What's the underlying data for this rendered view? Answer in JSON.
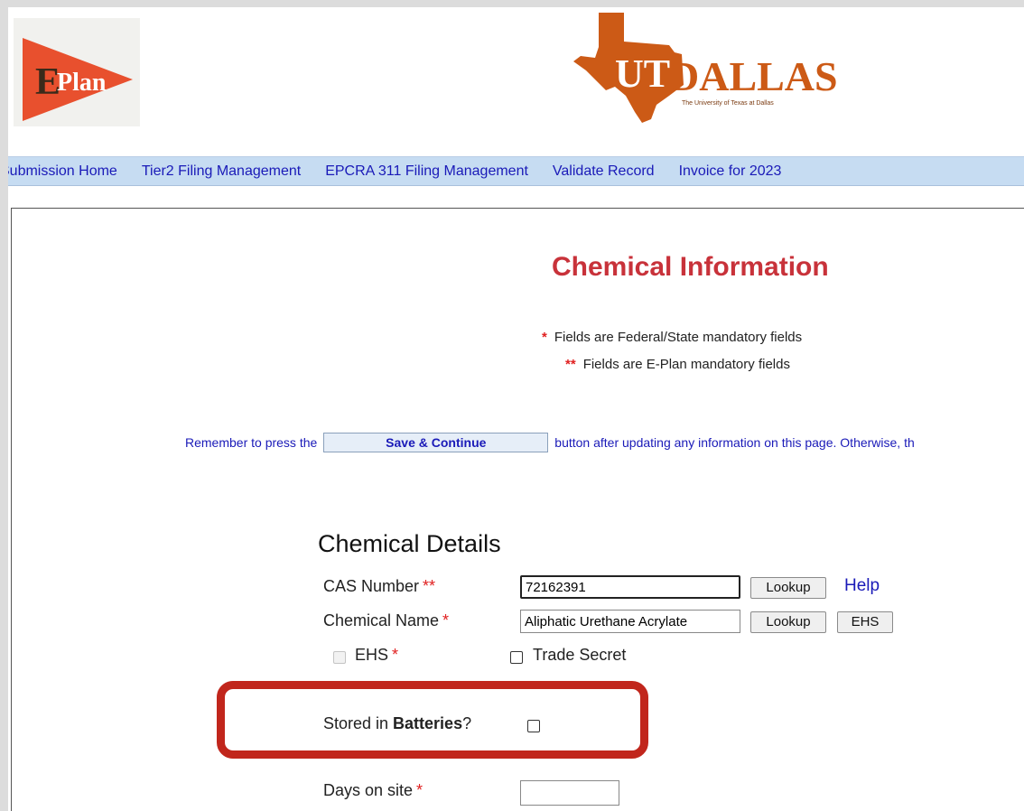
{
  "header": {
    "eplan_logo": {
      "letter": "E",
      "word": "Plan"
    },
    "utd_logo": {
      "name": "UT DALLAS",
      "tagline": "The University of Texas at Dallas"
    }
  },
  "nav": {
    "items": [
      "Submission Home",
      "Tier2 Filing Management",
      "EPCRA 311 Filing Management",
      "Validate Record",
      "Invoice for 2023"
    ]
  },
  "main": {
    "title": "Chemical Information",
    "legend": {
      "federal_marker": "*",
      "federal_text": "Fields are Federal/State mandatory fields",
      "eplan_marker": "**",
      "eplan_text": "Fields are E-Plan mandatory fields"
    },
    "reminder": {
      "prefix": "Remember to press the",
      "button_label": "Save & Continue",
      "suffix": "button after updating any information on this page. Otherwise, th"
    }
  },
  "details": {
    "section_title": "Chemical Details",
    "cas": {
      "label": "CAS Number",
      "required": "**",
      "value": "72162391",
      "lookup_label": "Lookup",
      "help_label": "Help"
    },
    "name": {
      "label": "Chemical Name",
      "required": "*",
      "value": "Aliphatic Urethane Acrylate",
      "lookup_label": "Lookup",
      "ehs_label": "EHS"
    },
    "ehs": {
      "label": "EHS",
      "required": "*",
      "checked": false,
      "disabled": true
    },
    "trade_secret": {
      "label": "Trade Secret",
      "checked": false
    },
    "batteries": {
      "label_prefix": "Stored in ",
      "label_bold": "Batteries",
      "label_suffix": "?",
      "checked": false
    },
    "days_on_site": {
      "label": "Days on site",
      "required": "*",
      "value": ""
    }
  },
  "colors": {
    "title_red": "#c8323a",
    "link_blue": "#1a1ab8",
    "nav_bg": "#c6dcf2",
    "highlight": "#c1261c",
    "eplan_orange": "#e8502e",
    "utd_orange": "#cc5a16"
  }
}
